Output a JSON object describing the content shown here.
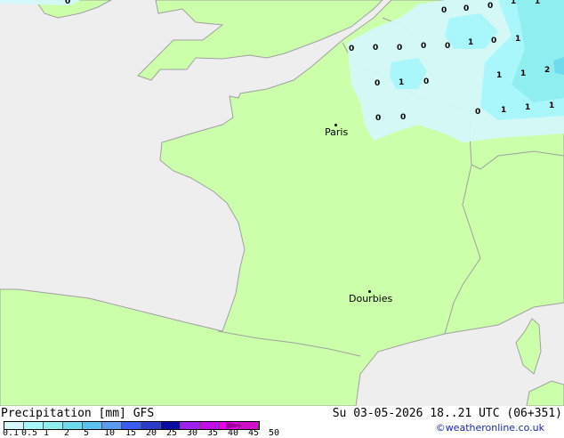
{
  "title": "Precipitation [mm] GFS",
  "datetime": "Su 03-05-2026 18..21 UTC (06+351)",
  "credit": "©weatheronline.co.uk",
  "legend": {
    "ticks": [
      "0.1",
      "0.5",
      "1",
      "2",
      "5",
      "10",
      "15",
      "20",
      "25",
      "30",
      "35",
      "40",
      "45",
      "50"
    ],
    "colors": [
      "#d4f8fa",
      "#aaf7fb",
      "#8eeef0",
      "#6fdcee",
      "#5ac4ee",
      "#5c9cee",
      "#3a5cf0",
      "#2a3cc8",
      "#0c0ca0",
      "#a020f0",
      "#c010e8",
      "#f000f0",
      "#d010c8"
    ]
  },
  "cities": [
    {
      "name": "Paris"
    },
    {
      "name": "Dourbies"
    }
  ],
  "values": [
    "0",
    "0",
    "0",
    "0",
    "0",
    "0",
    "1",
    "0",
    "0",
    "0",
    "0",
    "0",
    "1",
    "0",
    "1",
    "1",
    "1",
    "2",
    "0",
    "0",
    "1",
    "1",
    "1",
    "0",
    "1",
    "1"
  ],
  "colors": {
    "land": "#ccff aa",
    "sea": "#eeeeee",
    "border": "#a0a0a0"
  }
}
